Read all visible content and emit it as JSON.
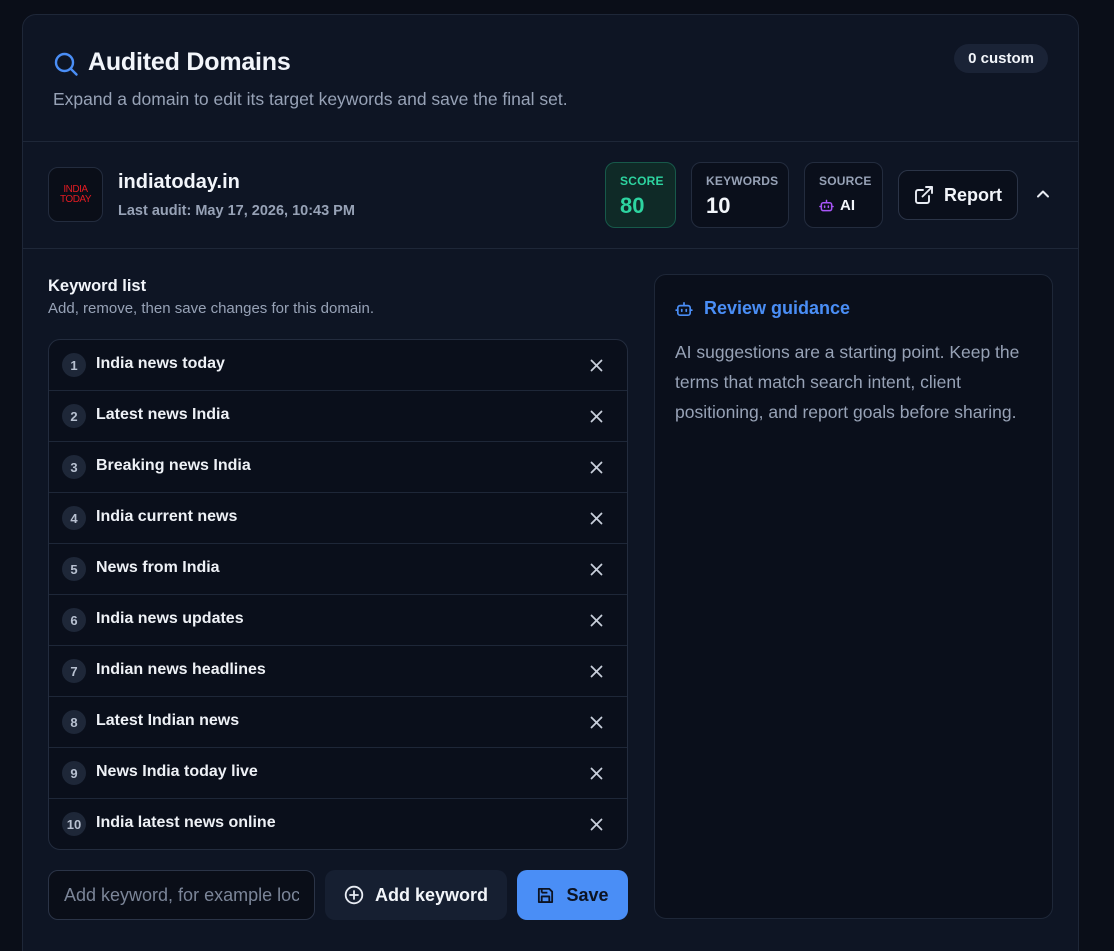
{
  "header": {
    "title": "Audited Domains",
    "subtitle": "Expand a domain to edit its target keywords and save the final set.",
    "custom_badge": "0 custom",
    "icon": "search-icon"
  },
  "domain": {
    "logo_line1": "INDIA",
    "logo_line2": "TODAY",
    "name": "indiatoday.in",
    "last_audit": "Last audit: May 17, 2026, 10:43 PM",
    "score_label": "SCORE",
    "score_value": "80",
    "keywords_label": "KEYWORDS",
    "keywords_value": "10",
    "source_label": "SOURCE",
    "source_value": "AI",
    "report_label": "Report",
    "colors": {
      "score": "#2dd4a0",
      "ai_icon": "#a855f7",
      "accent": "#4a8ef6"
    }
  },
  "keywords": {
    "title": "Keyword list",
    "subtitle": "Add, remove, then save changes for this domain.",
    "items": [
      {
        "num": "1",
        "text": "India news today"
      },
      {
        "num": "2",
        "text": "Latest news India"
      },
      {
        "num": "3",
        "text": "Breaking news India"
      },
      {
        "num": "4",
        "text": "India current news"
      },
      {
        "num": "5",
        "text": "News from India"
      },
      {
        "num": "6",
        "text": "India news updates"
      },
      {
        "num": "7",
        "text": "Indian news headlines"
      },
      {
        "num": "8",
        "text": "Latest Indian news"
      },
      {
        "num": "9",
        "text": "News India today live"
      },
      {
        "num": "10",
        "text": "India latest news online"
      }
    ],
    "input_placeholder": "Add keyword, for example local SEO",
    "add_label": "Add keyword",
    "save_label": "Save"
  },
  "guidance": {
    "title": "Review guidance",
    "text": "AI suggestions are a starting point. Keep the terms that match search intent, client positioning, and report goals before sharing."
  }
}
